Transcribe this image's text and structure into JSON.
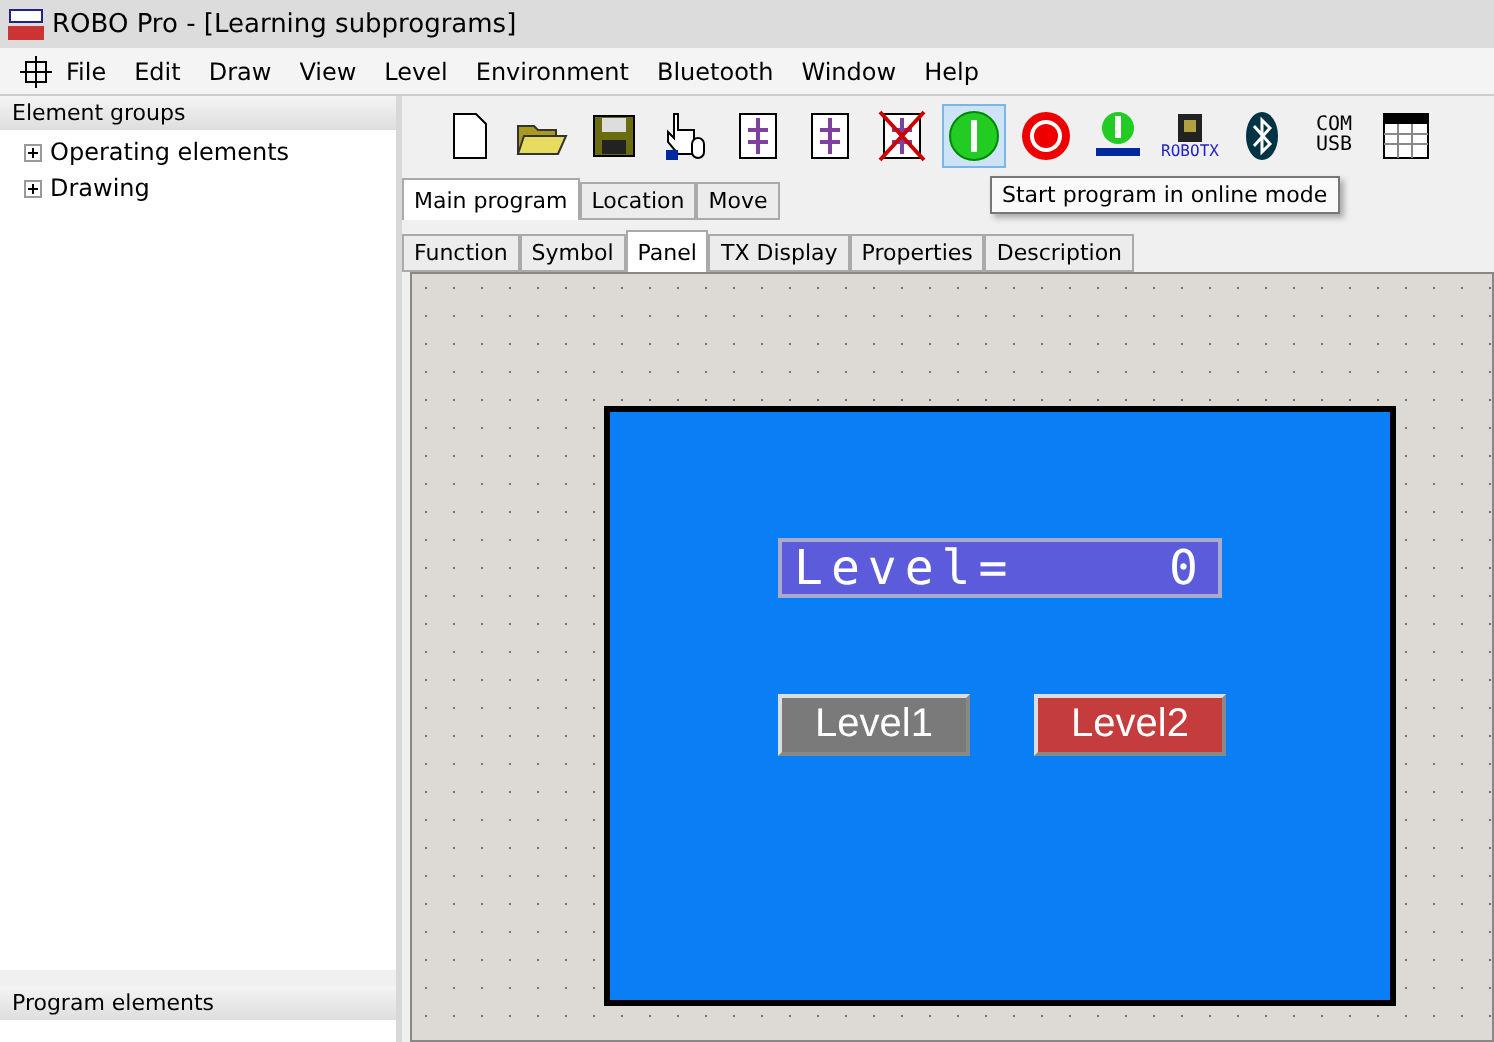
{
  "window": {
    "title": "ROBO Pro - [Learning subprograms]"
  },
  "menu": [
    "File",
    "Edit",
    "Draw",
    "View",
    "Level",
    "Environment",
    "Bluetooth",
    "Window",
    "Help"
  ],
  "element_groups": {
    "title": "Element groups",
    "items": [
      {
        "label": "Operating elements",
        "expanded": false
      },
      {
        "label": "Drawing",
        "expanded": false
      }
    ]
  },
  "program_elements": {
    "title": "Program elements"
  },
  "toolbar": [
    {
      "kind": "new",
      "selected": false
    },
    {
      "kind": "open",
      "selected": false
    },
    {
      "kind": "save",
      "selected": false
    },
    {
      "kind": "hand",
      "selected": false
    },
    {
      "kind": "subprogram",
      "selected": false
    },
    {
      "kind": "copy",
      "selected": false
    },
    {
      "kind": "delete",
      "selected": false
    },
    {
      "kind": "start",
      "selected": true
    },
    {
      "kind": "stop",
      "selected": false
    },
    {
      "kind": "download",
      "selected": false
    },
    {
      "kind": "controller",
      "selected": false,
      "label": "ROBOTX"
    },
    {
      "kind": "bluetooth",
      "selected": false
    },
    {
      "kind": "port",
      "selected": false,
      "label": "COM",
      "label2": "USB"
    },
    {
      "kind": "table",
      "selected": false
    }
  ],
  "tooltip": "Start program in online mode",
  "program_tabs": [
    {
      "label": "Main program",
      "selected": true
    },
    {
      "label": "Location",
      "selected": false
    },
    {
      "label": "Move",
      "selected": false
    }
  ],
  "view_tabs": [
    {
      "label": "Function",
      "selected": false
    },
    {
      "label": "Symbol",
      "selected": false
    },
    {
      "label": "Panel",
      "selected": true
    },
    {
      "label": "TX Display",
      "selected": false
    },
    {
      "label": "Properties",
      "selected": false
    },
    {
      "label": "Description",
      "selected": false
    }
  ],
  "panel": {
    "display": {
      "label": "Level=",
      "value": "0"
    },
    "buttons": [
      {
        "label": "Level1",
        "color": "#7a7a7a"
      },
      {
        "label": "Level2",
        "color": "#c43c3c"
      }
    ]
  }
}
